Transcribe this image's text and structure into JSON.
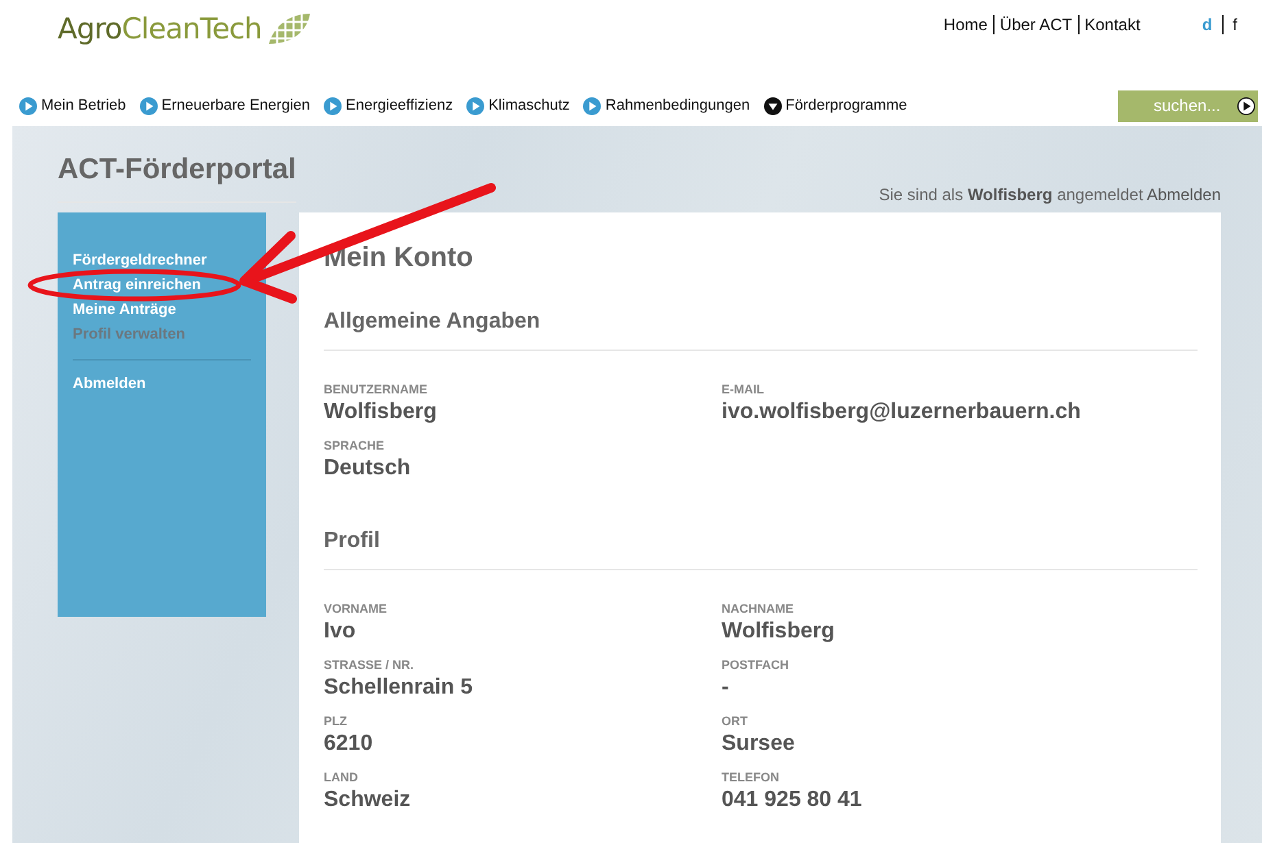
{
  "logo": {
    "text": "**Agro**CleanTech"
  },
  "top_links": [
    {
      "label": "Home"
    },
    {
      "label": "Über ACT"
    },
    {
      "label": "Kontakt"
    }
  ],
  "languages": [
    {
      "label": "d",
      "selected": true
    },
    {
      "label": "f",
      "selected": false
    }
  ],
  "nav": [
    {
      "label": "Mein Betrieb",
      "kind": "link"
    },
    {
      "label": "Erneuerbare Energien",
      "kind": "link"
    },
    {
      "label": "Energieeffizienz",
      "kind": "link"
    },
    {
      "label": "Klimaschutz",
      "kind": "link"
    },
    {
      "label": "Rahmenbedingungen",
      "kind": "link"
    },
    {
      "label": "Förderprogramme",
      "kind": "dropdown"
    }
  ],
  "search": {
    "placeholder": "suchen..."
  },
  "portal_title": "ACT-Förderportal",
  "login_status": {
    "before": "Sie sind als",
    "user": "Wolfisberg",
    "after": "angemeldet",
    "logout": "Abmelden"
  },
  "sidebar": {
    "items": [
      {
        "label": "Fördergeldrechner",
        "selected": false
      },
      {
        "label": "Antrag einreichen",
        "selected": false
      },
      {
        "label": "Meine Anträge",
        "selected": false
      },
      {
        "label": "Profil verwalten",
        "selected": true
      }
    ],
    "footer_items": [
      {
        "label": "Abmelden"
      }
    ]
  },
  "page_title": "Mein Konto",
  "sections": [
    {
      "title": "Allgemeine Angaben",
      "fields": [
        {
          "label": "BENUTZERNAME",
          "value": "Wolfisberg"
        },
        {
          "label": "E-MAIL",
          "value": "ivo.wolfisberg@luzernerbauern.ch"
        },
        {
          "label": "SPRACHE",
          "value": "Deutsch"
        }
      ]
    },
    {
      "title": "Profil",
      "fields": [
        {
          "label": "VORNAME",
          "value": "Ivo"
        },
        {
          "label": "NACHNAME",
          "value": "Wolfisberg"
        },
        {
          "label": "STRASSE / NR.",
          "value": "Schellenrain 5"
        },
        {
          "label": "POSTFACH",
          "value": "-"
        },
        {
          "label": "PLZ",
          "value": "6210"
        },
        {
          "label": "ORT",
          "value": "Sursee"
        },
        {
          "label": "LAND",
          "value": "Schweiz"
        },
        {
          "label": "TELEFON",
          "value": "041 925 80 41"
        }
      ]
    }
  ]
}
